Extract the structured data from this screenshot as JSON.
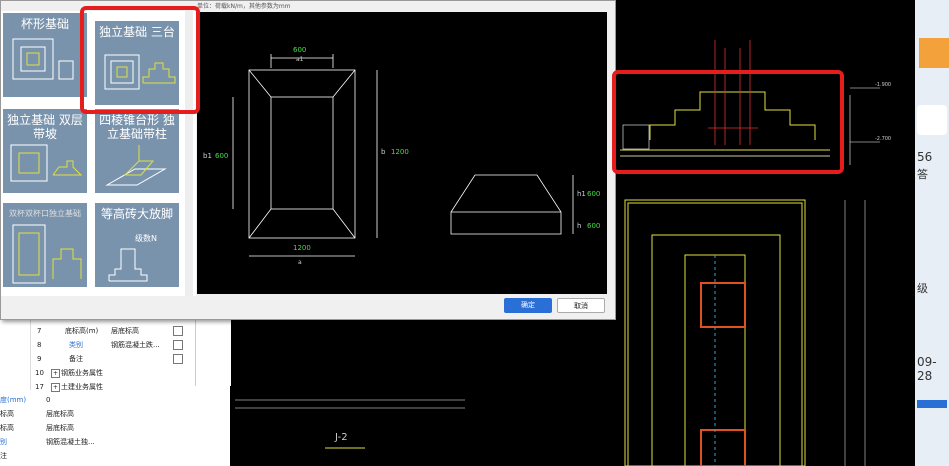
{
  "dialog": {
    "header_text": "单位：荷载kN/m，其他参数为mm",
    "ok_label": "确定",
    "cancel_label": "取消"
  },
  "tiles": [
    {
      "title": "杯形基础"
    },
    {
      "title": "独立基础 三台"
    },
    {
      "title": "独立基础 双层带坡"
    },
    {
      "title": "四棱锥台形 独立基础带柱"
    },
    {
      "title": "双杯双杯口独立基础"
    },
    {
      "title": "等高砖大放脚"
    }
  ],
  "tile_labels": {
    "step_count": "级数N"
  },
  "preview": {
    "dim_top_width": "600",
    "dim_top_label": "a1",
    "dim_b1_label": "b1",
    "dim_b1_value": "600",
    "dim_b_label": "b",
    "dim_b_value": "1200",
    "dim_bottom_width": "1200",
    "dim_bottom_label": "a",
    "dim_h1_label": "h1",
    "dim_h1_value": "600",
    "dim_h_label": "h",
    "dim_h_value": "600"
  },
  "properties": {
    "rows": [
      {
        "num": "7",
        "name": "底标高(m)",
        "value": "层底标高",
        "checkbox": true
      },
      {
        "num": "8",
        "name": "类别",
        "value": "钢筋混凝土跌...",
        "checkbox": true
      },
      {
        "num": "9",
        "name": "备注",
        "value": "",
        "checkbox": true
      },
      {
        "num": "10",
        "name": "钢筋业务属性",
        "value": "",
        "checkbox": false
      },
      {
        "num": "17",
        "name": "土建业务属性",
        "value": "",
        "checkbox": false
      }
    ],
    "lower_rows": [
      {
        "name": "度(mm)",
        "value": "0"
      },
      {
        "name": "标高",
        "value": "层底标高"
      },
      {
        "name": "标高",
        "value": "层底标高"
      },
      {
        "name": "别",
        "value": "钢筋混凝土独..."
      },
      {
        "name": "注",
        "value": ""
      }
    ]
  },
  "cad": {
    "title": "J-2",
    "elev_top": "-1.900",
    "elev_bottom": "-2.700"
  },
  "right_strip": {
    "text1": "56",
    "text2": "答",
    "text3": "级",
    "text4": "09-28"
  }
}
